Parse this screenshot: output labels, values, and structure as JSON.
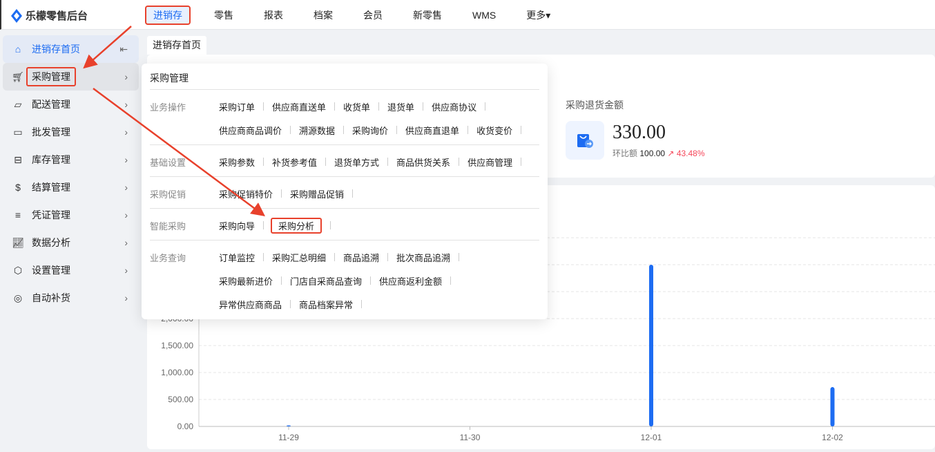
{
  "app": {
    "title": "乐檬零售后台"
  },
  "nav": [
    "进销存",
    "零售",
    "报表",
    "档案",
    "会员",
    "新零售",
    "WMS",
    "更多▾"
  ],
  "sidebar": [
    {
      "label": "进销存首页",
      "icon": "home-icon"
    },
    {
      "label": "采购管理",
      "icon": "cart-icon"
    },
    {
      "label": "配送管理",
      "icon": "map-icon"
    },
    {
      "label": "批发管理",
      "icon": "wholesale-icon"
    },
    {
      "label": "库存管理",
      "icon": "inventory-icon"
    },
    {
      "label": "结算管理",
      "icon": "dollar-icon"
    },
    {
      "label": "凭证管理",
      "icon": "voucher-icon"
    },
    {
      "label": "数据分析",
      "icon": "chart-icon"
    },
    {
      "label": "设置管理",
      "icon": "settings-icon"
    },
    {
      "label": "自动补货",
      "icon": "auto-replenish-icon"
    }
  ],
  "tab": "进销存首页",
  "dropdown": {
    "title": "采购管理",
    "groups": [
      {
        "label": "业务操作",
        "rows": [
          [
            "采购订单",
            "供应商直送单",
            "收货单",
            "退货单",
            "供应商协议"
          ],
          [
            "供应商商品调价",
            "溯源数据",
            "采购询价",
            "供应商直退单",
            "收货变价"
          ]
        ]
      },
      {
        "label": "基础设置",
        "rows": [
          [
            "采购参数",
            "补货参考值",
            "退货单方式",
            "商品供货关系",
            "供应商管理"
          ]
        ]
      },
      {
        "label": "采购促销",
        "rows": [
          [
            "采购促销特价",
            "采购赠品促销"
          ]
        ]
      },
      {
        "label": "智能采购",
        "rows": [
          [
            "采购向导",
            "采购分析"
          ]
        ]
      },
      {
        "label": "业务查询",
        "rows": [
          [
            "订单监控",
            "采购汇总明细",
            "商品追溯",
            "批次商品追溯"
          ],
          [
            "采购最新进价",
            "门店自采商品查询",
            "供应商返利金额"
          ],
          [
            "异常供应商商品",
            "商品档案异常"
          ]
        ]
      }
    ]
  },
  "stat": {
    "title": "采购退货金额",
    "value": "330.00",
    "compare_label": "环比额",
    "compare_value": "100.00",
    "change": "43.48%"
  },
  "chart_data": {
    "type": "bar",
    "categories": [
      "11-29",
      "11-30",
      "12-01",
      "12-02"
    ],
    "values": [
      20,
      0,
      3000,
      730
    ],
    "ylim": [
      0,
      3500
    ],
    "yticks": [
      "0.00",
      "500.00",
      "1,000.00",
      "1,500.00",
      "2,000.00"
    ],
    "color": "#1d6cf2"
  }
}
